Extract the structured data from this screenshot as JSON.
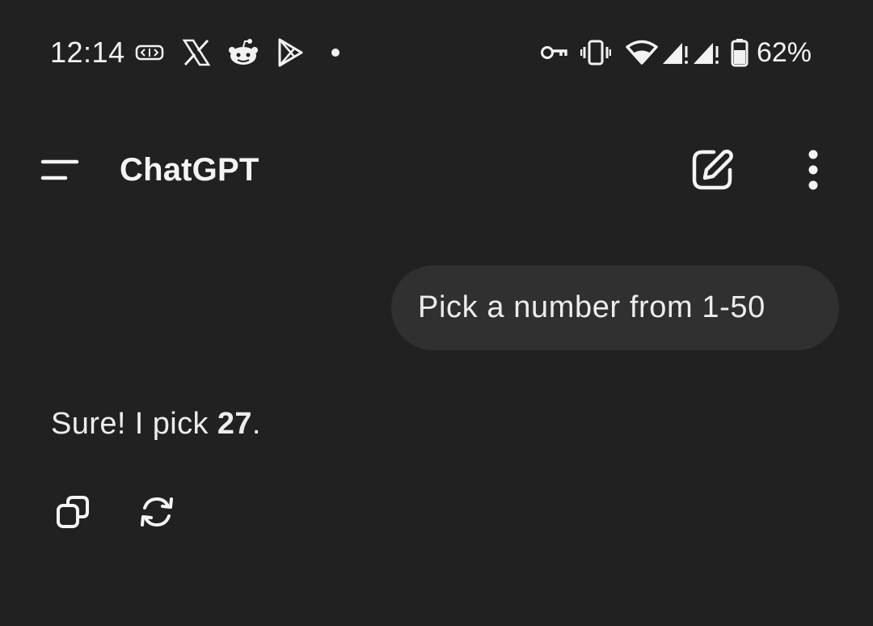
{
  "status_bar": {
    "time": "12:14",
    "battery_percent": "62%",
    "left_icons": [
      "cast-pill-icon",
      "x-icon",
      "reddit-icon",
      "play-store-icon",
      "notification-dot-icon"
    ],
    "right_icons": [
      "vpn-key-icon",
      "vibrate-icon",
      "wifi-icon",
      "signal-1-icon",
      "signal-2-icon",
      "battery-icon"
    ]
  },
  "app_bar": {
    "title": "ChatGPT",
    "menu_icon": "menu-icon",
    "new_chat_icon": "edit-icon",
    "more_icon": "more-vertical-icon"
  },
  "conversation": {
    "user_message": "Pick a number from 1-50",
    "assistant_message": {
      "prefix": "Sure! I pick ",
      "emphasis": "27",
      "suffix": "."
    },
    "actions": {
      "copy_icon": "copy-icon",
      "regenerate_icon": "regenerate-icon"
    }
  },
  "colors": {
    "background": "#212121",
    "bubble": "#303030",
    "text": "#ececec"
  }
}
